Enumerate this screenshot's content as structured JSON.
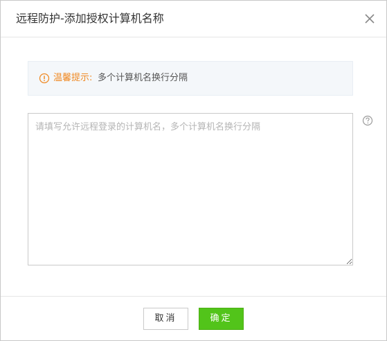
{
  "dialog": {
    "title": "远程防护-添加授权计算机名称",
    "close_icon": "close-icon"
  },
  "tip": {
    "icon": "warning-circle-icon",
    "prefix": "温馨提示:",
    "text": "多个计算机名换行分隔",
    "accent_color": "#f08a24"
  },
  "input": {
    "value": "",
    "placeholder": "请填写允许远程登录的计算机名，多个计算机名换行分隔",
    "help_icon": "question-circle-icon"
  },
  "footer": {
    "cancel_label": "取消",
    "ok_label": "确定",
    "ok_color": "#52c41a"
  }
}
